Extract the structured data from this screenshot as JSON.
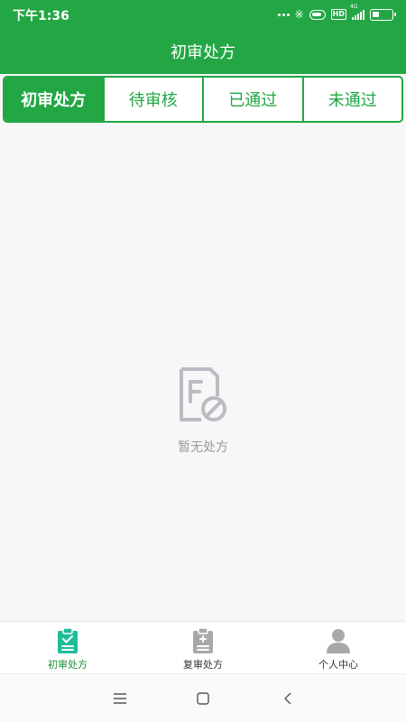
{
  "status_bar": {
    "time": "下午1:36",
    "network_label": "4G",
    "hd_label": "HD",
    "battery_level": 0.35,
    "icons": [
      "more-dots-icon",
      "bluetooth-icon",
      "pill-icon",
      "hd-icon",
      "signal-icon",
      "battery-icon"
    ]
  },
  "header": {
    "title": "初审处方"
  },
  "tabs": [
    {
      "label": "初审处方",
      "active": true
    },
    {
      "label": "待审核",
      "active": false
    },
    {
      "label": "已通过",
      "active": false
    },
    {
      "label": "未通过",
      "active": false
    }
  ],
  "empty_state": {
    "text": "暂无处方",
    "icon": "no-prescription-icon"
  },
  "bottom_nav": [
    {
      "label": "初审处方",
      "icon": "clipboard-check-icon",
      "active": true
    },
    {
      "label": "复审处方",
      "icon": "clipboard-list-icon",
      "active": false
    },
    {
      "label": "个人中心",
      "icon": "person-icon",
      "active": false
    }
  ],
  "colors": {
    "brand": "#22a744",
    "active_tab_text": "#ffffff",
    "active_nav_icon": "#1ebd9a",
    "inactive_nav_icon": "#a8a8a8",
    "empty_text": "#9a9a9a"
  }
}
